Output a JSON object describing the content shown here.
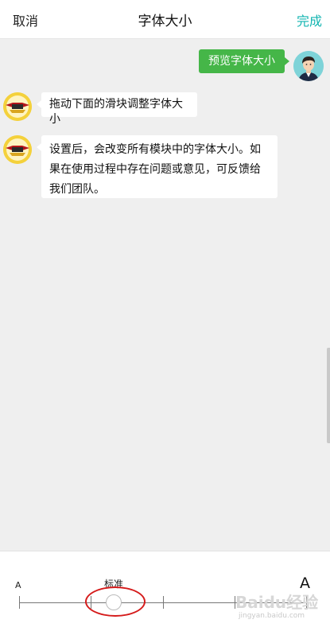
{
  "header": {
    "cancel_label": "取消",
    "title": "字体大小",
    "done_label": "完成"
  },
  "chat": {
    "self_message": "预览字体大小",
    "bot_messages": [
      "拖动下面的滑块调整字体大小",
      "设置后，会改变所有模块中的字体大小。如果在使用过程中存在问题或意见，可反馈给我们团队。"
    ]
  },
  "font_slider": {
    "small_label": "A",
    "standard_label": "标准",
    "large_label": "A",
    "steps": 5,
    "selected_step": 2
  },
  "watermark": {
    "text": "Baidu经验",
    "sub": "jingyan.baidu.com"
  },
  "colors": {
    "accent": "#13b5b1",
    "self_bubble": "#45b648",
    "annotation": "#d51b1b"
  },
  "icons": [
    "user-avatar-icon",
    "bot-badge-icon"
  ]
}
